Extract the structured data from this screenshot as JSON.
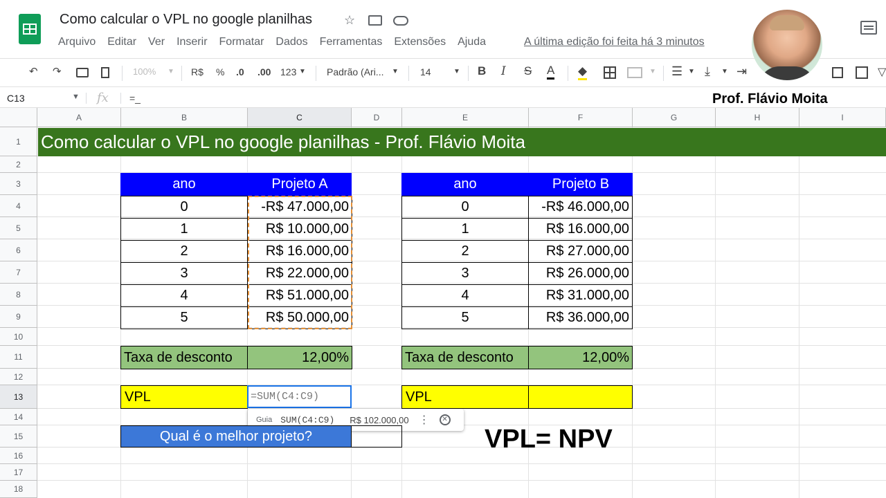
{
  "header": {
    "doc_title": "Como calcular o VPL no google planilhas",
    "menu": [
      "Arquivo",
      "Editar",
      "Ver",
      "Inserir",
      "Formatar",
      "Dados",
      "Ferramentas",
      "Extensões",
      "Ajuda"
    ],
    "last_edit": "A última edição foi feita há 3 minutos"
  },
  "toolbar": {
    "zoom": "100%",
    "currency": "R$",
    "percent": "%",
    "dec_less": ".0",
    "dec_more": ".00",
    "more_formats": "123",
    "font": "Padrão (Ari...",
    "font_size": "14",
    "bold": "B",
    "italic": "I",
    "strike": "S",
    "text_color": "A"
  },
  "formula_bar": {
    "cell_ref": "C13",
    "fx": "fx",
    "content": "=_"
  },
  "columns": [
    "A",
    "B",
    "C",
    "D",
    "E",
    "F",
    "G",
    "H",
    "I"
  ],
  "rows": [
    "1",
    "2",
    "3",
    "4",
    "5",
    "6",
    "7",
    "8",
    "9",
    "10",
    "11",
    "12",
    "13",
    "14",
    "15",
    "16",
    "17",
    "18"
  ],
  "sheet": {
    "title": "Como calcular o VPL no google planilhas - Prof. Flávio Moita",
    "table_a": {
      "headers": [
        "ano",
        "Projeto A"
      ],
      "rows": [
        [
          "0",
          "-R$ 47.000,00"
        ],
        [
          "1",
          "R$ 10.000,00"
        ],
        [
          "2",
          "R$ 16.000,00"
        ],
        [
          "3",
          "R$ 22.000,00"
        ],
        [
          "4",
          "R$ 51.000,00"
        ],
        [
          "5",
          "R$ 50.000,00"
        ]
      ],
      "rate_label": "Taxa de desconto",
      "rate_value": "12,00%",
      "vpl_label": "VPL",
      "vpl_formula": "=SUM(C4:C9)"
    },
    "table_b": {
      "headers": [
        "ano",
        "Projeto B"
      ],
      "rows": [
        [
          "0",
          "-R$ 46.000,00"
        ],
        [
          "1",
          "R$ 16.000,00"
        ],
        [
          "2",
          "R$ 27.000,00"
        ],
        [
          "3",
          "R$ 26.000,00"
        ],
        [
          "4",
          "R$ 31.000,00"
        ],
        [
          "5",
          "R$ 36.000,00"
        ]
      ],
      "rate_label": "Taxa de desconto",
      "rate_value": "12,00%",
      "vpl_label": "VPL",
      "vpl_value": ""
    },
    "question": "Qual é o melhor projeto?",
    "question_answer": ""
  },
  "formula_hint": {
    "guide": "Guia",
    "func": "SUM(C4:C9)",
    "result": "R$ 102.000,00"
  },
  "overlay": {
    "equation": "VPL= NPV",
    "presenter": "Prof. Flávio Moita"
  },
  "colors": {
    "title_bg": "#38761d",
    "header_blue": "#0000ff",
    "rate_green": "#93c47d",
    "vpl_yellow": "#ffff00",
    "question_blue": "#3c78d8"
  }
}
